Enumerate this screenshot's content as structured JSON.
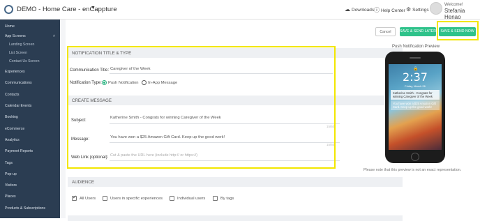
{
  "app": {
    "title": "DEMO - Home Care - enCappture",
    "caret": "▼"
  },
  "topbar": {
    "downloads": "Downloads",
    "help_center": "Help Center",
    "settings": "Settings",
    "welcome": "Welcome!",
    "username": "Stefania Henao"
  },
  "sidebar": {
    "items": [
      {
        "label": "Home"
      },
      {
        "label": "App Screens"
      },
      {
        "label": "Landing Screen"
      },
      {
        "label": "List Screen"
      },
      {
        "label": "Contact Us Screen"
      },
      {
        "label": "Experiences"
      },
      {
        "label": "Communications"
      },
      {
        "label": "Contacts"
      },
      {
        "label": "Calendar Events"
      },
      {
        "label": "Booking"
      },
      {
        "label": "eCommerce"
      },
      {
        "label": "Analytics"
      },
      {
        "label": "Payment Reports"
      },
      {
        "label": "Tags"
      },
      {
        "label": "Pop-up"
      },
      {
        "label": "Visitors"
      },
      {
        "label": "Places"
      },
      {
        "label": "Products & Subscriptions"
      }
    ]
  },
  "actions": {
    "cancel": "Cancel",
    "save_later": "SAVE & SEND LATER",
    "save_now": "SAVE & SEND NOW"
  },
  "notification_section": {
    "heading": "NOTIFICATION TITLE & TYPE",
    "title_label": "Communication Title:",
    "title_value": "Caregiver of the Week",
    "type_label": "Notification Type:",
    "type_push": "Push Notification",
    "type_inapp": "In-App Message"
  },
  "message_section": {
    "heading": "CREATE MESSAGE",
    "subject_label": "Subject:",
    "subject_value": "Katherine Smith - Congrats for winning Caregiver of the Week",
    "subject_counter": "15/60",
    "message_label": "Message:",
    "message_value": "You have won a $25 Amazon Gift Card. Keep up the good work!",
    "message_counter": "15/60",
    "weblink_label": "Web Link (optional):",
    "weblink_placeholder": "Cut & paste the URL here (include http:// or https://)"
  },
  "audience_section": {
    "heading": "AUDIENCE",
    "options": [
      {
        "label": "All Users",
        "checked": true
      },
      {
        "label": "Users in specific experiences",
        "checked": false
      },
      {
        "label": "Individual users",
        "checked": false
      },
      {
        "label": "By tags",
        "checked": false
      }
    ]
  },
  "preview": {
    "title": "Push Notification Preview",
    "time": "2:37",
    "date": "Friday, March 26",
    "notif_title": "Katherine Smith - Congrats for winning Caregiver of the Week",
    "notif_body": "You have won a $25 Amazon Gift Card. Keep up the good work!",
    "note": "Please note that this preview is not an exact representation."
  }
}
